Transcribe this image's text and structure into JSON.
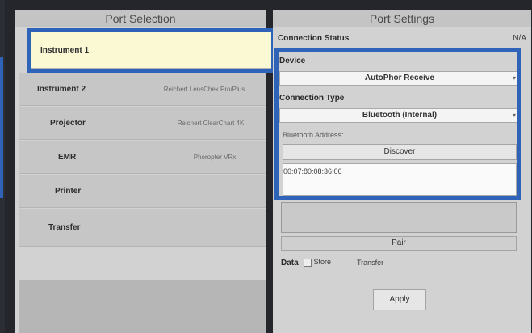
{
  "port_selection": {
    "title": "Port Selection",
    "ports": [
      {
        "name": "Instrument 1",
        "model": ""
      },
      {
        "name": "Instrument 2",
        "model": "Reichert LensChek Pro/Plus"
      },
      {
        "name": "Projector",
        "model": "Reichert ClearChart 4K"
      },
      {
        "name": "EMR",
        "model": "Phoropter VRx"
      },
      {
        "name": "Printer",
        "model": ""
      },
      {
        "name": "Transfer",
        "model": ""
      }
    ]
  },
  "port_settings": {
    "title": "Port Settings",
    "connection_status_label": "Connection Status",
    "connection_status_value": "N/A",
    "device_label": "Device",
    "device_value": "AutoPhor Receive",
    "connection_type_label": "Connection Type",
    "connection_type_value": "Bluetooth (Internal)",
    "bluetooth_address_label": "Bluetooth Address:",
    "discover_label": "Discover",
    "addresses": [
      "00:07:80:08:36:06"
    ],
    "pair_label": "Pair",
    "data_label": "Data",
    "store_label": "Store",
    "transfer_label": "Transfer",
    "apply_label": "Apply"
  },
  "colors": {
    "accent": "#2f63b8",
    "selected_row": "#fbf8d4"
  },
  "icons": {
    "dropdown": "chevron-down-icon"
  }
}
